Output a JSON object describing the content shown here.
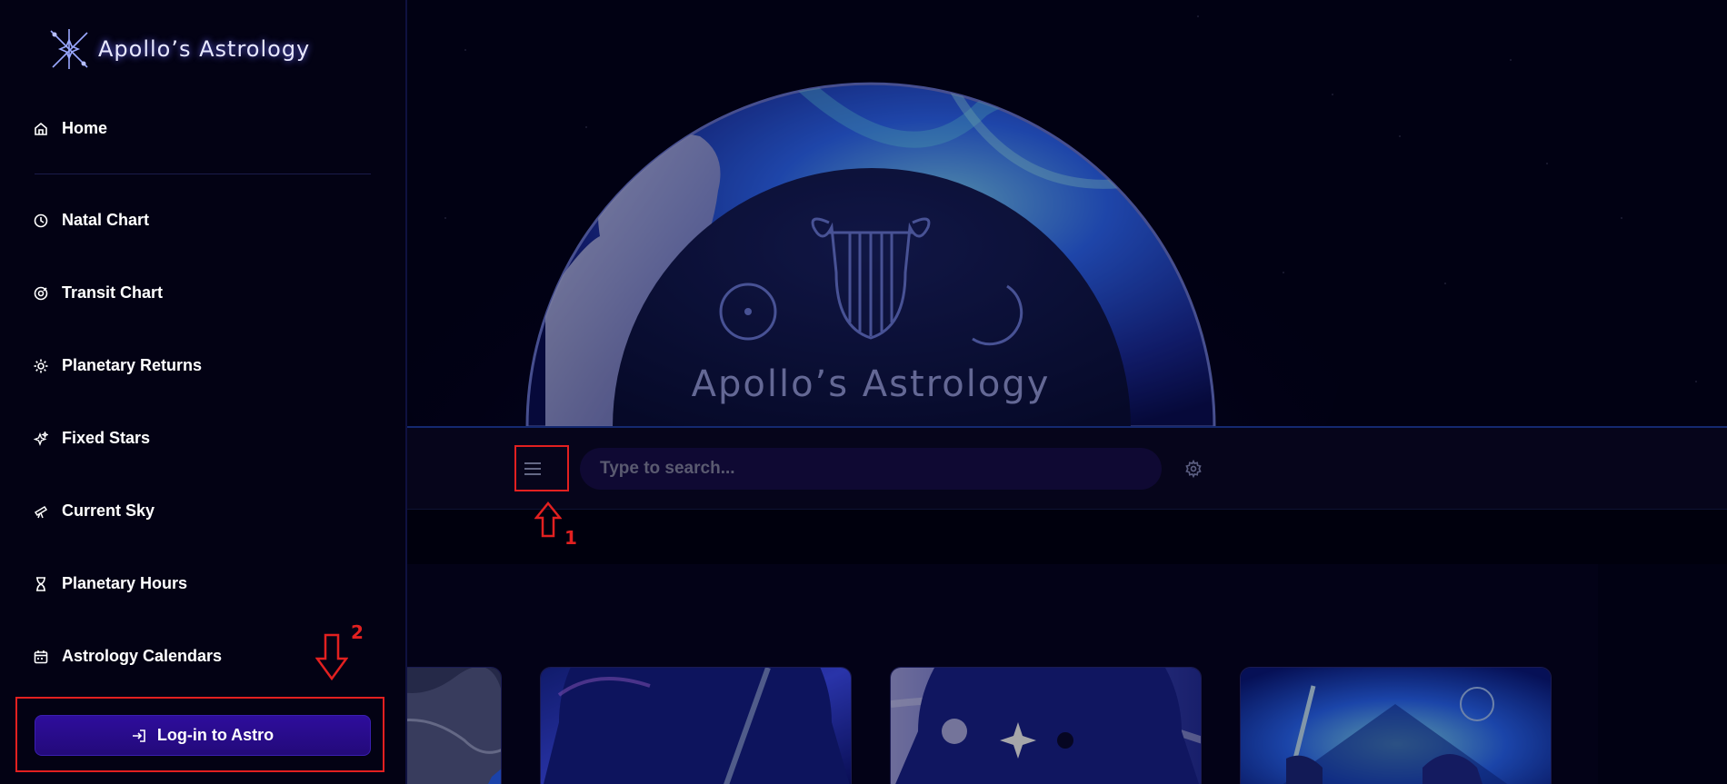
{
  "app": {
    "name": "Apollo's Astrology",
    "logo_text": "Apollo’s Astrology"
  },
  "sidebar": {
    "items": [
      {
        "label": "Home",
        "icon": "home-icon"
      },
      {
        "label": "Natal Chart",
        "icon": "chart-icon"
      },
      {
        "label": "Transit Chart",
        "icon": "transit-icon"
      },
      {
        "label": "Planetary Returns",
        "icon": "sun-icon"
      },
      {
        "label": "Fixed Stars",
        "icon": "sparkle-icon"
      },
      {
        "label": "Current Sky",
        "icon": "telescope-icon"
      },
      {
        "label": "Planetary Hours",
        "icon": "hourglass-icon"
      },
      {
        "label": "Astrology Calendars",
        "icon": "calendar-icon"
      }
    ],
    "login_label": "Log-in to Astro"
  },
  "hero": {
    "banner_text": "Apollo’s Astrology"
  },
  "toolbar": {
    "search_placeholder": "Type to search...",
    "menu_icon": "hamburger-menu-icon",
    "settings_icon": "gear-icon"
  },
  "annotations": {
    "marker_1": "1",
    "marker_2": "2",
    "color": "#e22020"
  },
  "colors": {
    "background": "#03021a",
    "sidebar": "#030214",
    "accent": "#2e0d9c",
    "search_bg": "#180f4a"
  }
}
